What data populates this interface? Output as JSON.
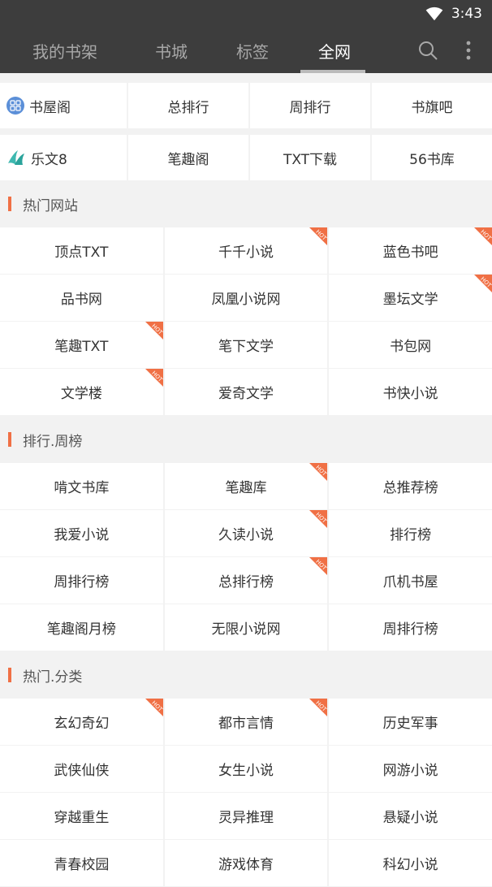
{
  "status": {
    "time": "3:43"
  },
  "tabs": [
    {
      "label": "我的书架",
      "active": false
    },
    {
      "label": "书城",
      "active": false
    },
    {
      "label": "标签",
      "active": false
    },
    {
      "label": "全网",
      "active": true
    }
  ],
  "tab_icons": [
    "search-icon",
    "more-vert-icon"
  ],
  "quick_rows": [
    [
      "书屋阁",
      "总排行",
      "周排行",
      "书旗吧"
    ],
    [
      "乐文8",
      "笔趣阁",
      "TXT下载",
      "56书库"
    ]
  ],
  "sections": [
    {
      "title": "热门网站",
      "items": [
        {
          "label": "顶点TXT",
          "hot": false
        },
        {
          "label": "千千小说",
          "hot": true
        },
        {
          "label": "蓝色书吧",
          "hot": true
        },
        {
          "label": "品书网",
          "hot": false
        },
        {
          "label": "凤凰小说网",
          "hot": false
        },
        {
          "label": "墨坛文学",
          "hot": true
        },
        {
          "label": "笔趣TXT",
          "hot": true
        },
        {
          "label": "笔下文学",
          "hot": false
        },
        {
          "label": "书包网",
          "hot": false
        },
        {
          "label": "文学楼",
          "hot": true
        },
        {
          "label": "爱奇文学",
          "hot": false
        },
        {
          "label": "书快小说",
          "hot": false
        }
      ]
    },
    {
      "title": "排行.周榜",
      "items": [
        {
          "label": "啃文书库",
          "hot": false
        },
        {
          "label": "笔趣库",
          "hot": true
        },
        {
          "label": "总推荐榜",
          "hot": false
        },
        {
          "label": "我爱小说",
          "hot": false
        },
        {
          "label": "久读小说",
          "hot": true
        },
        {
          "label": "排行榜",
          "hot": false
        },
        {
          "label": "周排行榜",
          "hot": false
        },
        {
          "label": "总排行榜",
          "hot": true
        },
        {
          "label": "爪机书屋",
          "hot": false
        },
        {
          "label": "笔趣阁月榜",
          "hot": false
        },
        {
          "label": "无限小说网",
          "hot": false
        },
        {
          "label": "周排行榜",
          "hot": false
        }
      ]
    },
    {
      "title": "热门.分类",
      "items": [
        {
          "label": "玄幻奇幻",
          "hot": true
        },
        {
          "label": "都市言情",
          "hot": true
        },
        {
          "label": "历史军事",
          "hot": false
        },
        {
          "label": "武侠仙侠",
          "hot": false
        },
        {
          "label": "女生小说",
          "hot": false
        },
        {
          "label": "网游小说",
          "hot": false
        },
        {
          "label": "穿越重生",
          "hot": false
        },
        {
          "label": "灵异推理",
          "hot": false
        },
        {
          "label": "悬疑小说",
          "hot": false
        },
        {
          "label": "青春校园",
          "hot": false
        },
        {
          "label": "游戏体育",
          "hot": false
        },
        {
          "label": "科幻小说",
          "hot": false
        }
      ]
    }
  ],
  "hot_badge_text": "HOT",
  "colors": {
    "header_bg": "#3d3d3d",
    "accent": "#f07045",
    "hot_badge": "#f07045"
  }
}
